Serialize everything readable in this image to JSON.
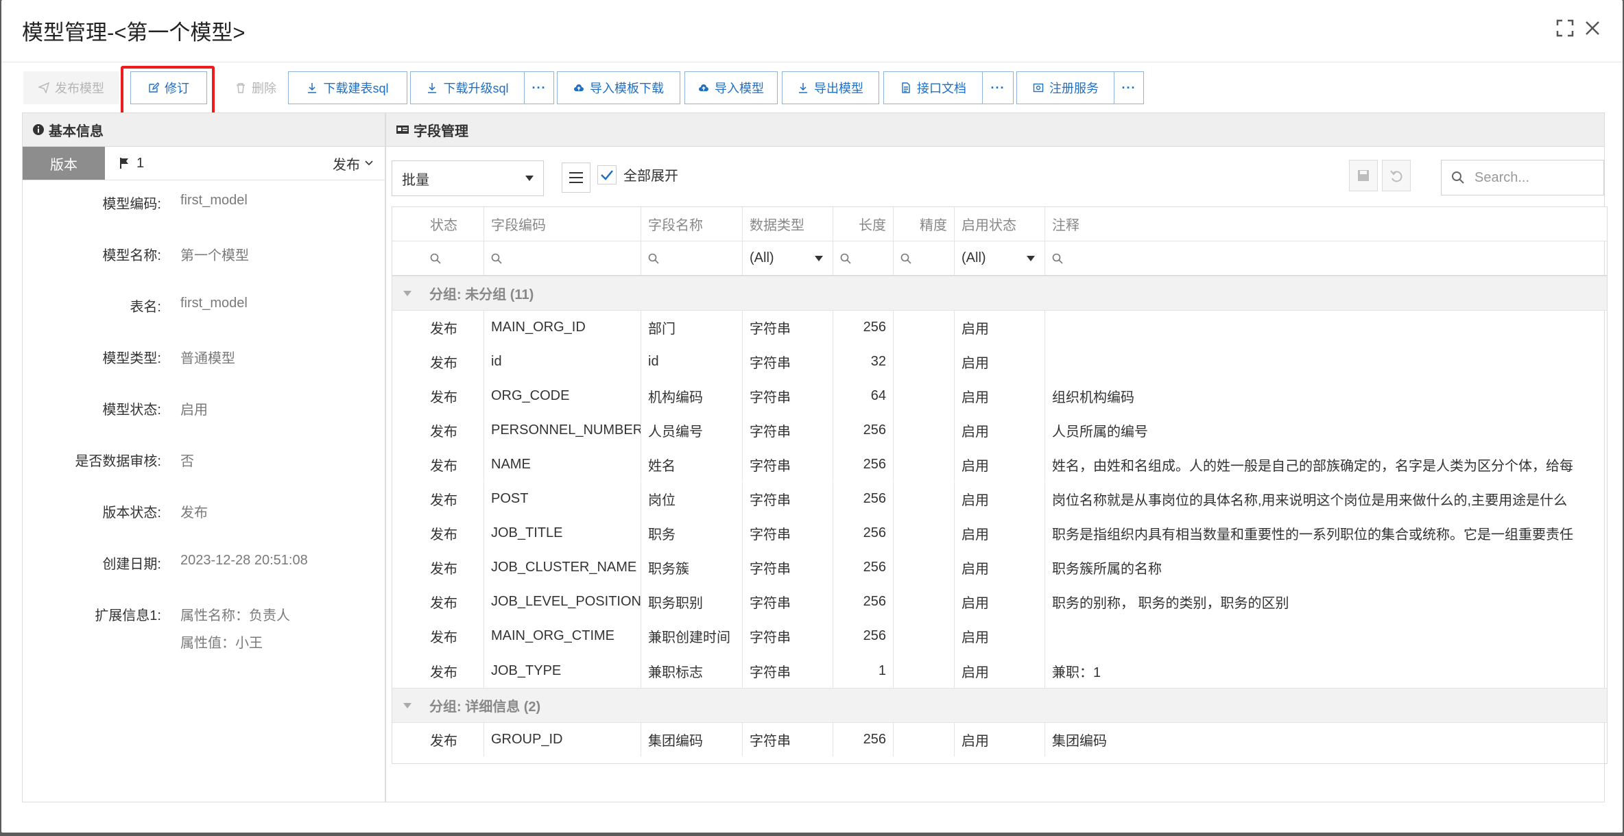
{
  "window": {
    "title": "模型管理-<第一个模型>"
  },
  "toolbar": {
    "publish": "发布模型",
    "revise": "修订",
    "delete": "删除",
    "download_create_sql": "下载建表sql",
    "download_upgrade_sql": "下载升级sql",
    "import_template_download": "导入模板下载",
    "import_model": "导入模型",
    "export_model": "导出模型",
    "api_doc": "接口文档",
    "register_service": "注册服务",
    "more": "···"
  },
  "left": {
    "header": "基本信息",
    "version_tab": "版本",
    "version_number": "1",
    "version_status_select": "发布",
    "fields": [
      {
        "label": "模型编码:",
        "value": "first_model"
      },
      {
        "label": "模型名称:",
        "value": "第一个模型"
      },
      {
        "label": "表名:",
        "value": "first_model"
      },
      {
        "label": "模型类型:",
        "value": "普通模型"
      },
      {
        "label": "模型状态:",
        "value": "启用"
      },
      {
        "label": "是否数据审核:",
        "value": "否"
      },
      {
        "label": "版本状态:",
        "value": "发布"
      },
      {
        "label": "创建日期:",
        "value": "2023-12-28 20:51:08"
      },
      {
        "label": "扩展信息1:",
        "value": "属性名称：负责人",
        "value2": "属性值：小王"
      }
    ]
  },
  "right": {
    "header": "字段管理",
    "batch_select": "批量",
    "expand_all": "全部展开",
    "search_placeholder": "Search...",
    "columns": [
      "状态",
      "字段编码",
      "字段名称",
      "数据类型",
      "长度",
      "精度",
      "启用状态",
      "注释"
    ],
    "filter_all": "(All)",
    "groups": [
      {
        "title": "分组: 未分组 (11)",
        "rows": [
          [
            "发布",
            "MAIN_ORG_ID",
            "部门",
            "字符串",
            "256",
            "",
            "启用",
            ""
          ],
          [
            "发布",
            "id",
            "id",
            "字符串",
            "32",
            "",
            "启用",
            ""
          ],
          [
            "发布",
            "ORG_CODE",
            "机构编码",
            "字符串",
            "64",
            "",
            "启用",
            "组织机构编码"
          ],
          [
            "发布",
            "PERSONNEL_NUMBER",
            "人员编号",
            "字符串",
            "256",
            "",
            "启用",
            "人员所属的编号"
          ],
          [
            "发布",
            "NAME",
            "姓名",
            "字符串",
            "256",
            "",
            "启用",
            "姓名，由姓和名组成。人的姓一般是自己的部族确定的，名字是人类为区分个体，给每"
          ],
          [
            "发布",
            "POST",
            "岗位",
            "字符串",
            "256",
            "",
            "启用",
            "岗位名称就是从事岗位的具体名称,用来说明这个岗位是用来做什么的,主要用途是什么"
          ],
          [
            "发布",
            "JOB_TITLE",
            "职务",
            "字符串",
            "256",
            "",
            "启用",
            "职务是指组织内具有相当数量和重要性的一系列职位的集合或统称。它是一组重要责任"
          ],
          [
            "发布",
            "JOB_CLUSTER_NAME",
            "职务簇",
            "字符串",
            "256",
            "",
            "启用",
            "职务簇所属的名称"
          ],
          [
            "发布",
            "JOB_LEVEL_POSITION",
            "职务职别",
            "字符串",
            "256",
            "",
            "启用",
            "职务的别称， 职务的类别，职务的区别"
          ],
          [
            "发布",
            "MAIN_ORG_CTIME",
            "兼职创建时间",
            "字符串",
            "256",
            "",
            "启用",
            ""
          ],
          [
            "发布",
            "JOB_TYPE",
            "兼职标志",
            "字符串",
            "1",
            "",
            "启用",
            "兼职：1"
          ]
        ]
      },
      {
        "title": "分组: 详细信息 (2)",
        "rows": [
          [
            "发布",
            "GROUP_ID",
            "集团编码",
            "字符串",
            "256",
            "",
            "启用",
            "集团编码"
          ]
        ]
      }
    ]
  }
}
